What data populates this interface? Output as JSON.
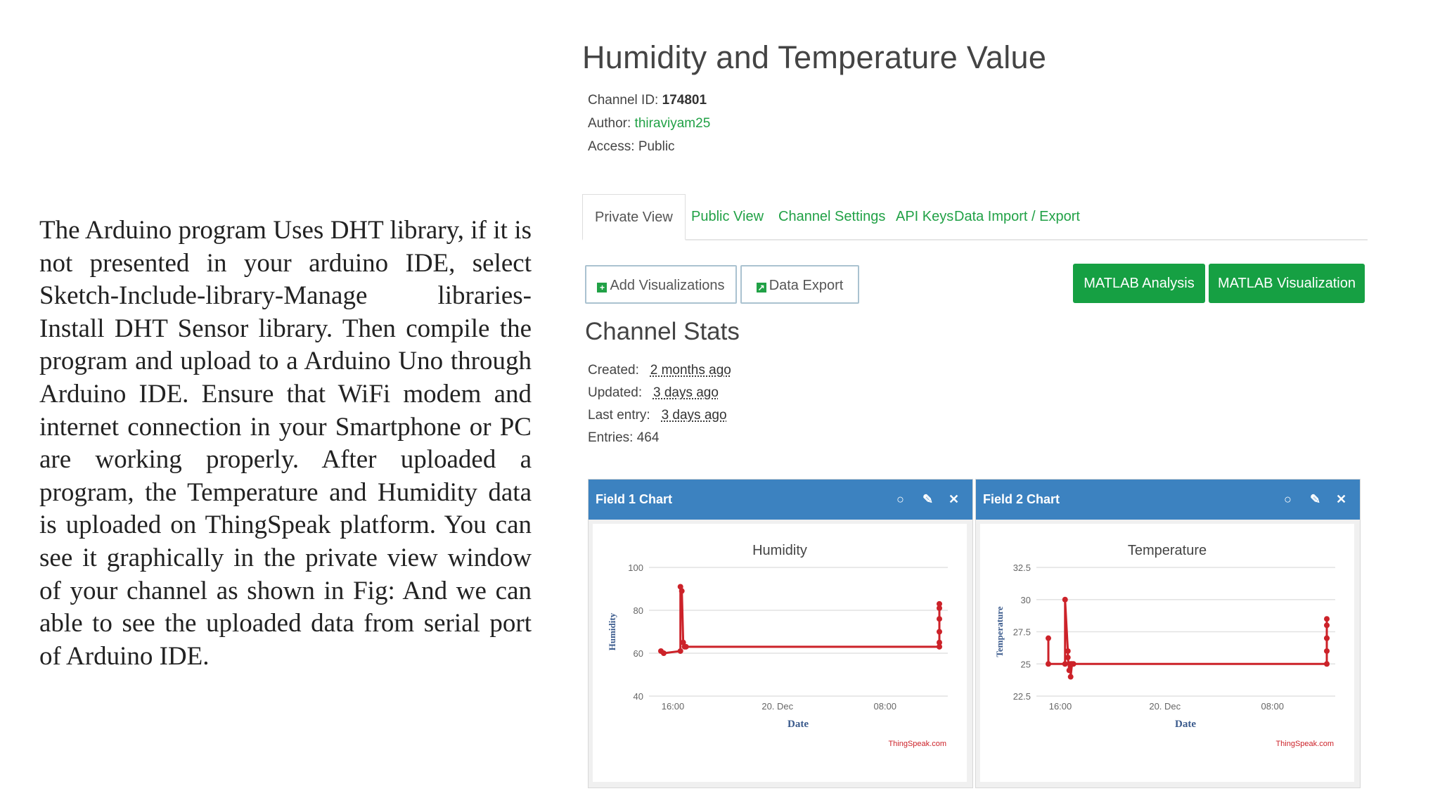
{
  "paragraph": "The Arduino program Uses DHT library, if it is not presented in your arduino IDE, select Sketch-Include-library-Manage libraries-Install DHT Sensor library. Then compile the program and upload to a Arduino Uno through Arduino IDE. Ensure that WiFi modem and internet connection in your Smartphone or PC are working properly. After uploaded a program, the Temperature and Humidity data is uploaded on ThingSpeak platform. You can see it graphically in the private view window of your channel as shown in Fig: And we can able to see the uploaded data from serial port of Arduino IDE.",
  "channel": {
    "title": "Humidity and Temperature Value",
    "id_label": "Channel ID:",
    "id": "174801",
    "author_label": "Author:",
    "author": "thiraviyam25",
    "access_label": "Access:",
    "access": "Public"
  },
  "tabs": [
    "Private View",
    "Public View",
    "Channel Settings",
    "API Keys",
    "Data Import / Export"
  ],
  "buttons": {
    "add_viz": "Add Visualizations",
    "data_export": "Data Export",
    "matlab_analysis": "MATLAB Analysis",
    "matlab_viz": "MATLAB Visualization"
  },
  "stats": {
    "title": "Channel Stats",
    "created_label": "Created:",
    "created": "2 months ago",
    "updated_label": "Updated:",
    "updated": "3 days ago",
    "last_label": "Last entry:",
    "last": "3 days ago",
    "entries_label": "Entries:",
    "entries": "464"
  },
  "colors": {
    "accent_green": "#16a043",
    "header_blue": "#3c82c0",
    "series_red": "#cc2229"
  },
  "icons": [
    "comment-icon",
    "pencil-icon",
    "close-icon",
    "plus-icon",
    "export-icon"
  ],
  "chart_data": [
    {
      "card_title": "Field 1 Chart",
      "type": "line",
      "title": "Humidity",
      "xlabel": "Date",
      "ylabel": "Humidity",
      "ylim": [
        40,
        100
      ],
      "yticks": [
        "100",
        "80",
        "60",
        "40"
      ],
      "xticks": [
        "16:00",
        "20. Dec",
        "08:00"
      ],
      "credit": "ThingSpeak.com",
      "series": [
        {
          "x": [
            0,
            0.01,
            0.07,
            0.07,
            0.075,
            0.08,
            0.085,
            0.09,
            1.0,
            1.0,
            1.0,
            1.0,
            1.0,
            1.0
          ],
          "values": [
            61,
            60,
            61,
            91,
            89,
            65,
            63,
            63,
            63,
            65,
            70,
            76,
            81,
            83
          ]
        }
      ]
    },
    {
      "card_title": "Field 2 Chart",
      "type": "line",
      "title": "Temperature",
      "xlabel": "Date",
      "ylabel": "Temperature",
      "ylim": [
        22.5,
        32.5
      ],
      "yticks": [
        "32.5",
        "30",
        "27.5",
        "25",
        "22.5"
      ],
      "xticks": [
        "16:00",
        "20. Dec",
        "08:00"
      ],
      "credit": "ThingSpeak.com",
      "series": [
        {
          "x": [
            0,
            0,
            0.06,
            0.06,
            0.07,
            0.07,
            0.075,
            0.08,
            0.08,
            0.085,
            0.09,
            1.0,
            1.0,
            1.0,
            1.0,
            1.0,
            1.0
          ],
          "values": [
            27,
            25,
            25,
            30,
            26,
            25.5,
            24.5,
            25,
            24,
            25,
            25,
            25,
            26,
            27,
            28,
            28.5,
            27
          ]
        }
      ]
    }
  ]
}
